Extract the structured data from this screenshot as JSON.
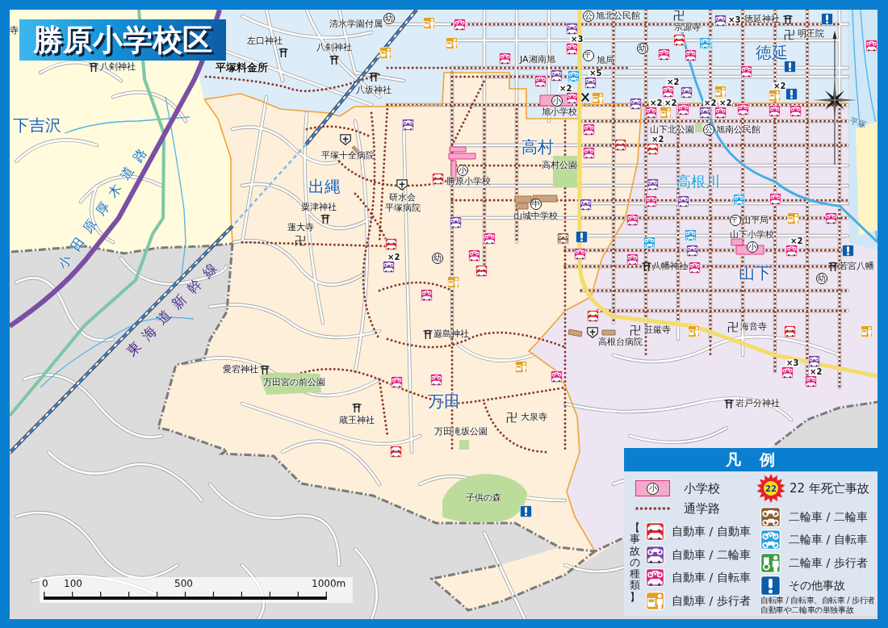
{
  "title": "勝原小学校区",
  "map": {
    "districts": [
      "下吉沢",
      "出縄",
      "高村",
      "徳延",
      "山下",
      "万田"
    ],
    "lines": [
      {
        "kind": "expressway",
        "label": "小田原厚木道路"
      },
      {
        "kind": "railway",
        "label": "東海道新幹線"
      },
      {
        "kind": "river",
        "label": "高根川"
      },
      {
        "kind": "road",
        "label": "平塚"
      }
    ],
    "places": [
      {
        "kind": "plain",
        "label": "寺"
      },
      {
        "kind": "shrine",
        "label": "左口神社"
      },
      {
        "kind": "shrine",
        "label": "八剣神社"
      },
      {
        "kind": "plain",
        "label": "平塚料金所"
      },
      {
        "kind": "circled",
        "symbol": "幼",
        "label": "清水学園付属"
      },
      {
        "kind": "shrine",
        "label": "八剣神社"
      },
      {
        "kind": "shrine",
        "label": "八坂神社"
      },
      {
        "kind": "circled",
        "symbol": "公",
        "label": "旭北公民館"
      },
      {
        "kind": "temple",
        "symbol": "卍",
        "label": "宗源寺"
      },
      {
        "kind": "shrine",
        "label": "徳延神社"
      },
      {
        "kind": "temple",
        "symbol": "卍",
        "label": "明王院"
      },
      {
        "kind": "plain",
        "label": "JA湘南旭"
      },
      {
        "kind": "circled",
        "symbol": "〒",
        "label": "旭局"
      },
      {
        "kind": "circled",
        "symbol": "幼"
      },
      {
        "kind": "circled",
        "symbol": "小",
        "label": "旭小学校"
      },
      {
        "kind": "police"
      },
      {
        "kind": "plain",
        "label": "山下北公園"
      },
      {
        "kind": "circled",
        "symbol": "公",
        "label": "旭南公民館"
      },
      {
        "kind": "plain",
        "label": "高村公園"
      },
      {
        "kind": "circled",
        "symbol": "小",
        "label": "勝原小学校"
      },
      {
        "kind": "hospital",
        "label": "平塚十全病院"
      },
      {
        "kind": "shrine",
        "label": "粟津神社"
      },
      {
        "kind": "hospital",
        "label": "研水会"
      },
      {
        "kind": "plain",
        "label": "平塚病院"
      },
      {
        "kind": "circled",
        "symbol": "中",
        "label": "山城中学校"
      },
      {
        "kind": "temple",
        "symbol": "卍",
        "label": "蓮大寺"
      },
      {
        "kind": "circled",
        "symbol": "〒",
        "label": "山下局"
      },
      {
        "kind": "circled",
        "symbol": "小",
        "label": "山下小学校"
      },
      {
        "kind": "shrine",
        "label": "八幡神社"
      },
      {
        "kind": "shrine",
        "label": "若宮八幡"
      },
      {
        "kind": "circled",
        "symbol": "幼"
      },
      {
        "kind": "circled",
        "symbol": "幼"
      },
      {
        "kind": "temple",
        "symbol": "卍",
        "label": "荘厳寺"
      },
      {
        "kind": "hospital",
        "label": "高根台病院"
      },
      {
        "kind": "temple",
        "symbol": "卍",
        "label": "海音寺"
      },
      {
        "kind": "shrine",
        "label": "巌島神社"
      },
      {
        "kind": "shrine",
        "label": "愛宕神社"
      },
      {
        "kind": "plain",
        "label": "万田宮の前公園"
      },
      {
        "kind": "shrine",
        "label": "岩戸分神社"
      },
      {
        "kind": "shrine",
        "label": "蔵王神社"
      },
      {
        "kind": "temple",
        "symbol": "卍",
        "label": "大泉寺"
      },
      {
        "kind": "plain",
        "label": "万田滝坂公園"
      },
      {
        "kind": "plain",
        "label": "子供の森"
      }
    ],
    "accidents": [
      {
        "kind": "car_ped"
      },
      {
        "kind": "car_ped"
      },
      {
        "kind": "car_moto"
      },
      {
        "kind": "car_car"
      },
      {
        "kind": "car_bike"
      },
      {
        "kind": "car_ped"
      },
      {
        "kind": "car_moto"
      },
      {
        "kind": "car_bike",
        "count": "×3"
      },
      {
        "kind": "car_bike"
      },
      {
        "kind": "car_bike"
      },
      {
        "kind": "car_moto"
      },
      {
        "kind": "moto_bike"
      },
      {
        "kind": "car_moto",
        "count": "×5"
      },
      {
        "kind": "car_bike",
        "count": "×2"
      },
      {
        "kind": "car_ped"
      },
      {
        "kind": "car_moto"
      },
      {
        "kind": "car_bike",
        "count": "×2"
      },
      {
        "kind": "car_ped",
        "count": "×2"
      },
      {
        "kind": "car_bike",
        "count": "×2"
      },
      {
        "kind": "car_moto"
      },
      {
        "kind": "car_bike"
      },
      {
        "kind": "car_moto",
        "count": "×2"
      },
      {
        "kind": "car_bike",
        "count": "×2"
      },
      {
        "kind": "car_ped"
      },
      {
        "kind": "car_bike"
      },
      {
        "kind": "car_ped",
        "count": "×2"
      },
      {
        "kind": "car_bike"
      },
      {
        "kind": "car_bike"
      },
      {
        "kind": "other"
      },
      {
        "kind": "other"
      },
      {
        "kind": "car_bike"
      },
      {
        "kind": "other"
      },
      {
        "kind": "car_moto",
        "count": "×3"
      },
      {
        "kind": "car_car"
      },
      {
        "kind": "moto_bike"
      },
      {
        "kind": "car_bike"
      },
      {
        "kind": "car_bike"
      },
      {
        "kind": "car_bike"
      },
      {
        "kind": "car_bike"
      },
      {
        "kind": "car_bike"
      },
      {
        "kind": "car_car"
      },
      {
        "kind": "car_car",
        "count": "×2"
      },
      {
        "kind": "car_moto"
      },
      {
        "kind": "car_bike"
      },
      {
        "kind": "car_moto"
      },
      {
        "kind": "moto_bike"
      },
      {
        "kind": "car_bike"
      },
      {
        "kind": "car_ped"
      },
      {
        "kind": "car_bike"
      },
      {
        "kind": "car_moto"
      },
      {
        "kind": "car_bike"
      },
      {
        "kind": "car_moto"
      },
      {
        "kind": "car_bike"
      },
      {
        "kind": "car_bike"
      },
      {
        "kind": "car_car"
      },
      {
        "kind": "car_ped"
      },
      {
        "kind": "moto_moto"
      },
      {
        "kind": "other"
      },
      {
        "kind": "car_bike"
      },
      {
        "kind": "moto_bike"
      },
      {
        "kind": "car_bike"
      },
      {
        "kind": "moto_bike"
      },
      {
        "kind": "car_moto"
      },
      {
        "kind": "car_bike"
      },
      {
        "kind": "car_bike",
        "count": "×2"
      },
      {
        "kind": "other"
      },
      {
        "kind": "car_car"
      },
      {
        "kind": "car_ped"
      },
      {
        "kind": "car_car"
      },
      {
        "kind": "car_ped"
      },
      {
        "kind": "car_moto"
      },
      {
        "kind": "car_bike",
        "count": "×3"
      },
      {
        "kind": "car_bike",
        "count": "×2"
      },
      {
        "kind": "car_ped"
      },
      {
        "kind": "car_bike"
      },
      {
        "kind": "car_car"
      },
      {
        "kind": "car_moto",
        "count": "×2"
      },
      {
        "kind": "car_bike"
      },
      {
        "kind": "car_bike"
      },
      {
        "kind": "car_bike"
      },
      {
        "kind": "car_car"
      },
      {
        "kind": "other"
      }
    ]
  },
  "scale_bar": {
    "labels": [
      "0",
      "100",
      "500",
      "1000m"
    ]
  },
  "legend": {
    "title": "凡　例",
    "school": {
      "symbol": "小",
      "label": "小学校"
    },
    "route": {
      "label": "通学路"
    },
    "accident_group": "【事故の種類】",
    "car_types": [
      {
        "kind": "car_car",
        "label": "自動車 / 自動車"
      },
      {
        "kind": "car_moto",
        "label": "自動車 / 二輪車"
      },
      {
        "kind": "car_bike",
        "label": "自動車 / 自転車"
      },
      {
        "kind": "car_ped",
        "label": "自動車 / 歩行者"
      }
    ],
    "fatal": {
      "number": "22",
      "label": "22 年死亡事故"
    },
    "other_types": [
      {
        "kind": "moto_moto",
        "label": "二輪車 / 二輪車"
      },
      {
        "kind": "moto_bike",
        "label": "二輪車 / 自転車"
      },
      {
        "kind": "moto_ped",
        "label": "二輪車 / 歩行者"
      },
      {
        "kind": "other",
        "label": "その他事故"
      }
    ],
    "note": [
      "自転車 / 自転車、自転車 / 歩行者",
      "自動車や二輪車の単独事故"
    ]
  }
}
